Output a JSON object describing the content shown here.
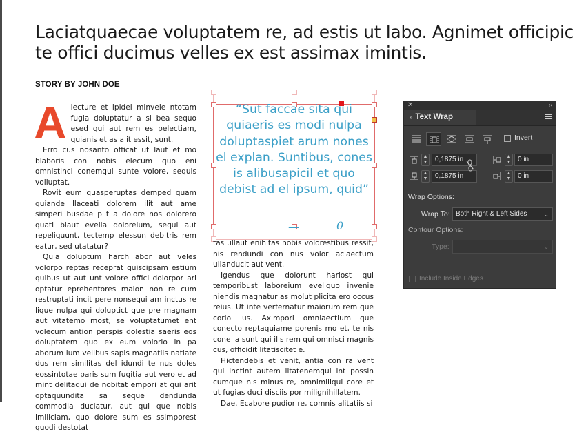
{
  "headline": "Laciatquaecae voluptatem re, ad estis ut labo. Agnimet officipic te offici ducimus velles ex est assimax imintis.",
  "byline": "STORY BY JOHN DOE",
  "dropcap": "A",
  "column1": [
    "lecture et ipidel minvele ntotam fugia doluptatur a si bea sequo esed qui aut rem es pelectiam, quianis et as alit essit, sunt.",
    "Erro cus nosanto officat ut laut et mo blaboris con nobis elecum quo eni omnistinci conemqui sunte volore, sequis volluptat.",
    "Rovit eum quasperuptas demped quam quiande llaceati dolorem ilit aut ame simperi busdae plit a dolore nos dolorero quati blaut evella doloreium, sequi aut repeliquunt, tectemp elessun debitris rem eatur, sed utatatur?",
    "Quia doluptum harchillabor aut veles volorpo reptas receprat quiscipsam estium quibus ut aut unt volore offici dolorpor ari optatur eprehentores maion non re cum restruptati incit pere nonsequi am inctus re lique nulpa qui doluptict que pre magnam aut vitatemo most, se voluptatumet ent volecum antion perspis dolestia saeris eos doluptatem quo ex eum volorio in pa aborum ium velibus sapis magnatiis natiate dus rem similitas del idundi te nus doles eossintotae paris sum fugitia aut vero et ad mint delitaqui de nobitat empori at qui arit optaquundita sa seque dendunda commodia duciatur, aut qui que nobis imiliciam, quo dolore sum es ssimporest quodi destotat"
  ],
  "pull_quote": "“Sut faccae sita qui quiaeris es modi nulpa doluptaspiet arum nones el explan. Suntibus, cones is alibusapicil et quo debist ad el ipsum, quid”",
  "pull_marks": [
    "—",
    "0"
  ],
  "column2": [
    "tas ullaut enihitas nobis volorestibus ressit, nis rendundi con nus volor aciaectum ullanducit aut vent.",
    "Igendus que dolorunt hariost qui temporibust laboreium eveliquo invenie niendis magnatur as molut plicita ero occus reius. Ut inte verfernatur maiorum rem que corio ius. Aximpori omniaectium que conecto reptaquiame porenis mo et, te nis cone la sunt qui ilis rem qui omnisci magnis cus, officidit litatiscitet e.",
    "Hictendebis et venit, antia con ra vent qui inctint autem litatenemqui int possin cumque nis minus re, omnimiliqui core et ut fugias duci disciis por milignihillatem.",
    "Dae. Ecabore pudior re, comnis alitatiis si"
  ],
  "panel": {
    "close": "✕",
    "collapse": "‹‹",
    "tab_title": "Text Wrap",
    "tab_prefix": "»",
    "wrap_buttons": [
      {
        "name": "no-wrap-icon",
        "selected": false
      },
      {
        "name": "wrap-bounding-box-icon",
        "selected": true
      },
      {
        "name": "wrap-object-shape-icon",
        "selected": false
      },
      {
        "name": "jump-object-icon",
        "selected": false
      },
      {
        "name": "jump-to-next-column-icon",
        "selected": false
      }
    ],
    "invert_label": "Invert",
    "offsets": {
      "top": "0,1875 in",
      "bottom": "0,1875 in",
      "left": "0 in",
      "right": "0 in"
    },
    "wrap_options_label": "Wrap Options:",
    "wrap_to_label": "Wrap To:",
    "wrap_to_value": "Both Right & Left Sides",
    "contour_options_label": "Contour Options:",
    "type_label": "Type:",
    "type_value": "",
    "include_inside_edges_label": "Include Inside Edges"
  }
}
